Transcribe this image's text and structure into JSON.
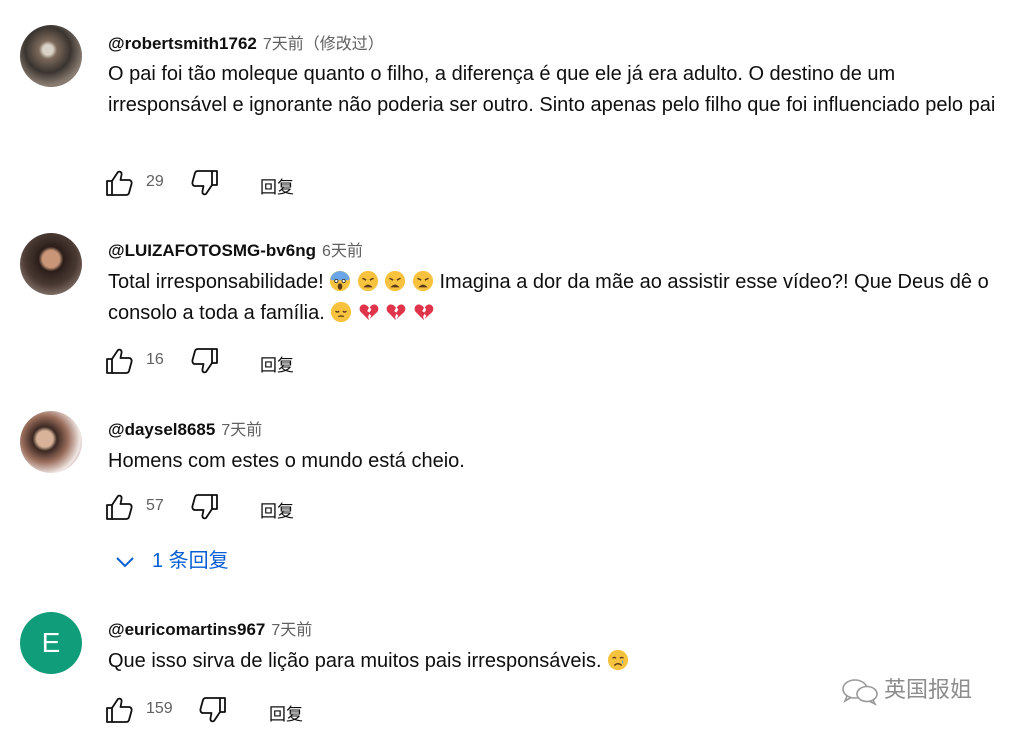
{
  "comments": [
    {
      "author": "@robertsmith1762",
      "time": "7天前（修改过）",
      "text": "O pai foi tão moleque quanto o filho, a diferença é que ele já era adulto. O destino de um irresponsável e ignorante não poderia ser outro. Sinto apenas pelo filho que foi influenciado pelo pai",
      "likes": "29",
      "reply_label": "回复"
    },
    {
      "author": "@LUIZAFOTOSMG-bv6ng",
      "time": "6天前",
      "text_before": "Total irresponsabilidade!",
      "text_middle": "Imagina a dor da mãe ao assistir esse vídeo?! Que Deus dê o consolo a toda a família.",
      "likes": "16",
      "reply_label": "回复"
    },
    {
      "author": "@daysel8685",
      "time": "7天前",
      "text": "Homens com estes o mundo está cheio.",
      "likes": "57",
      "reply_label": "回复",
      "replies_toggle": "1 条回复"
    },
    {
      "author": "@euricomartins967",
      "avatar_letter": "E",
      "time": "7天前",
      "text": "Que isso sirva de lição para muitos pais irresponsáveis.",
      "likes": "159",
      "reply_label": "回复"
    }
  ],
  "watermark": "英国报姐",
  "colors": {
    "link_blue": "#065fd4",
    "meta_gray": "#606060",
    "avatar_green": "#0f9d7a"
  },
  "icons": [
    "thumbs-up-icon",
    "thumbs-down-icon",
    "chevron-down-icon",
    "wechat-logo-icon"
  ]
}
